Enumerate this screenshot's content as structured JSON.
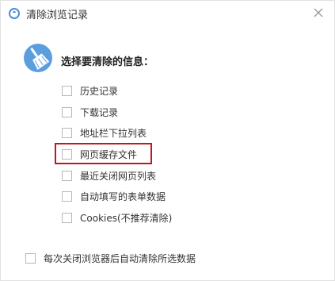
{
  "window": {
    "title": "清除浏览记录"
  },
  "heading": "选择要清除的信息：",
  "options": [
    {
      "label": "历史记录",
      "checked": false
    },
    {
      "label": "下载记录",
      "checked": false
    },
    {
      "label": "地址栏下拉列表",
      "checked": false
    },
    {
      "label": "网页缓存文件",
      "checked": false
    },
    {
      "label": "最近关闭网页列表",
      "checked": false
    },
    {
      "label": "自动填写的表单数据",
      "checked": false
    },
    {
      "label": "Cookies(不推荐清除)",
      "checked": false
    }
  ],
  "auto_clear": {
    "label": "每次关闭浏览器后自动清除所选数据",
    "checked": false
  },
  "colors": {
    "highlight": "#c0191d",
    "icon_blue": "#4a90d9"
  }
}
